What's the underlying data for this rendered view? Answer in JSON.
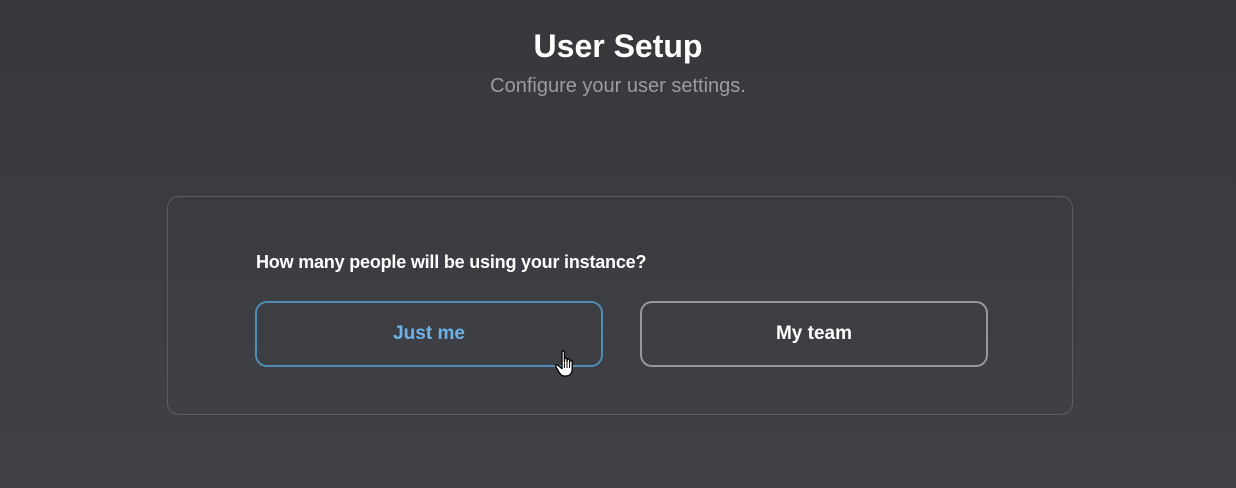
{
  "header": {
    "title": "User Setup",
    "subtitle": "Configure your user settings."
  },
  "card": {
    "question": "How many people will be using your instance?",
    "options": [
      {
        "label": "Just me",
        "state": "hovered"
      },
      {
        "label": "My team",
        "state": "default"
      }
    ]
  },
  "colors": {
    "background": "#3a3c41",
    "accent_blue": "#6cb2e6",
    "border_blue": "#4f8db4",
    "border_gray": "#96989c",
    "card_border": "#5a5c61",
    "subtitle": "#9a9ca1"
  },
  "cursor": {
    "icon": "hand-pointer-icon"
  }
}
